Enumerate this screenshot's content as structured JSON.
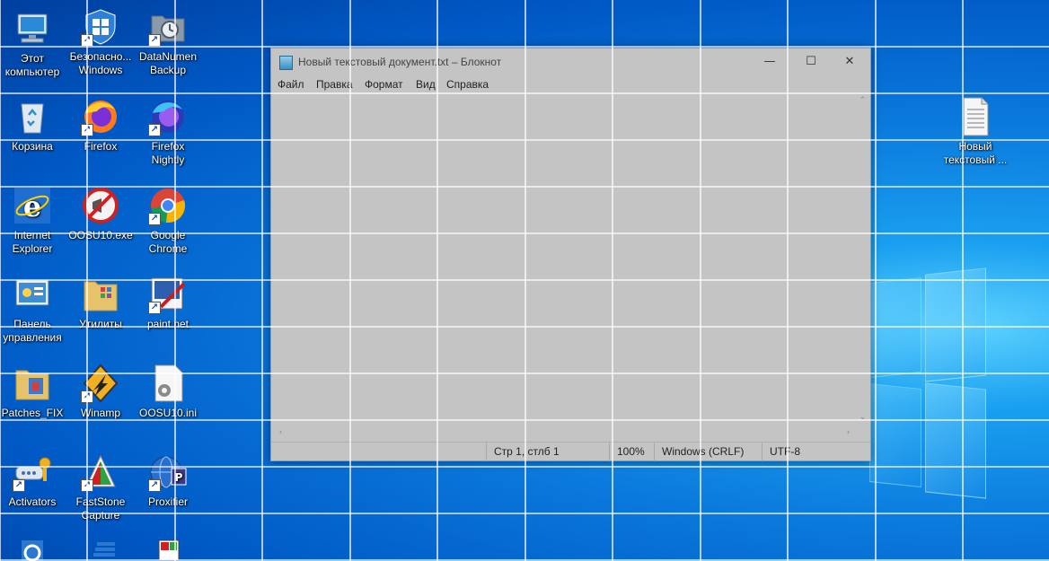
{
  "desktop": {
    "icons": [
      {
        "label": "Этот компьютер",
        "icon": "computer-icon",
        "shortcut": false
      },
      {
        "label": "Безопасно... Windows",
        "icon": "windows-security-shield-icon",
        "shortcut": true
      },
      {
        "label": "DataNumen Backup",
        "icon": "backup-folder-clock-icon",
        "shortcut": true
      },
      {
        "label": "Корзина",
        "icon": "recycle-bin-icon",
        "shortcut": false
      },
      {
        "label": "Firefox",
        "icon": "firefox-icon",
        "shortcut": true
      },
      {
        "label": "Firefox Nightly",
        "icon": "firefox-nightly-icon",
        "shortcut": true
      },
      {
        "label": "Internet Explorer",
        "icon": "internet-explorer-icon",
        "shortcut": false
      },
      {
        "label": "OOSU10.exe",
        "icon": "oosu10-icon",
        "shortcut": false
      },
      {
        "label": "Google Chrome",
        "icon": "chrome-icon",
        "shortcut": true
      },
      {
        "label": "Панель управления",
        "icon": "control-panel-icon",
        "shortcut": false
      },
      {
        "label": "Утилиты",
        "icon": "folder-icon",
        "shortcut": false
      },
      {
        "label": "paint.net",
        "icon": "paintnet-icon",
        "shortcut": true
      },
      {
        "label": "Patches_FIX",
        "icon": "folder-icon",
        "shortcut": false
      },
      {
        "label": "Winamp",
        "icon": "winamp-icon",
        "shortcut": true
      },
      {
        "label": "OOSU10.ini",
        "icon": "settings-file-icon",
        "shortcut": false
      },
      {
        "label": "Activators",
        "icon": "keys-icon",
        "shortcut": true
      },
      {
        "label": "FastStone Capture",
        "icon": "faststone-capture-icon",
        "shortcut": true
      },
      {
        "label": "Proxifier",
        "icon": "proxifier-icon",
        "shortcut": true
      },
      {
        "label": "",
        "icon": "gear-icon",
        "shortcut": false
      },
      {
        "label": "",
        "icon": "app-icon",
        "shortcut": false
      },
      {
        "label": "",
        "icon": "app-icon",
        "shortcut": false
      },
      {
        "label": "Новый текстовый ...",
        "icon": "text-file-icon",
        "shortcut": false
      }
    ]
  },
  "notepad": {
    "title": "Новый текстовый документ.txt – Блокнот",
    "controls": {
      "minimize": "—",
      "maximize": "☐",
      "close": "✕"
    },
    "menu": [
      "Файл",
      "Правка",
      "Формат",
      "Вид",
      "Справка"
    ],
    "content": "",
    "status": {
      "position": "Стр 1, стлб 1",
      "zoom": "100%",
      "line_endings": "Windows (CRLF)",
      "encoding": "UTF-8"
    }
  },
  "colors": {
    "desktop_blue": "#0a78dc",
    "window_overlay": "#c4c4c4",
    "grid_line": "#ffffff"
  }
}
